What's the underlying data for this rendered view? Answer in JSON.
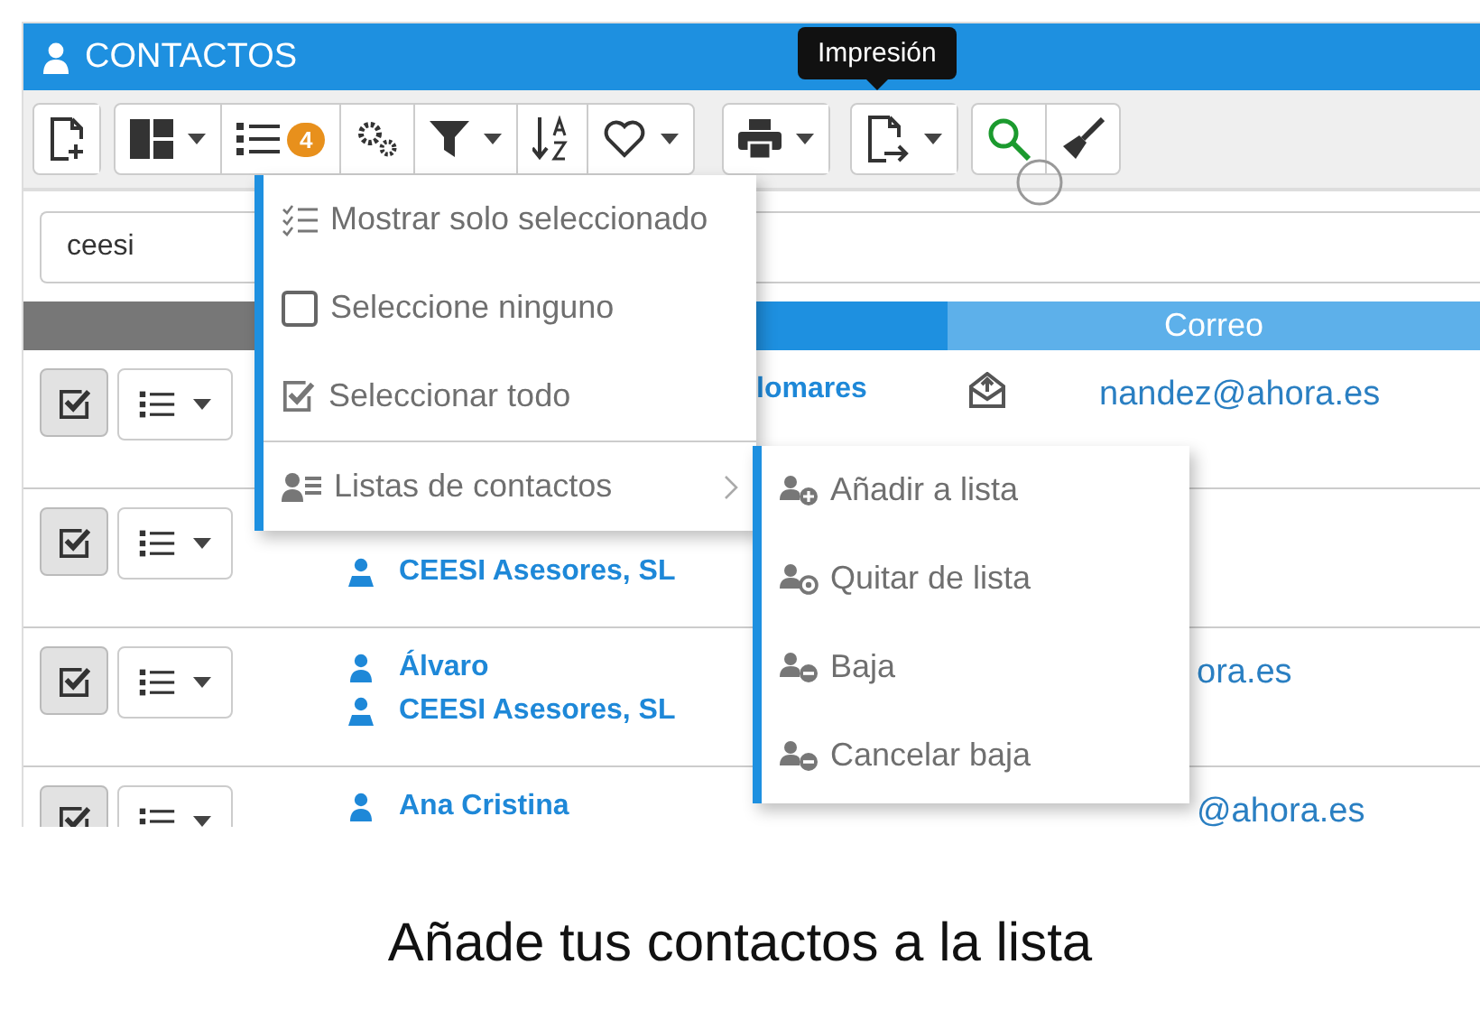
{
  "header": {
    "title": "CONTACTOS"
  },
  "toolbar": {
    "groups": [
      [
        {
          "kind": "new-doc",
          "dropdown": false
        }
      ],
      [
        {
          "kind": "layout",
          "dropdown": true
        },
        {
          "kind": "list",
          "dropdown": false,
          "badge": "4"
        },
        {
          "kind": "gears",
          "dropdown": false
        },
        {
          "kind": "filter",
          "dropdown": true
        },
        {
          "kind": "sort",
          "dropdown": false
        },
        {
          "kind": "heart",
          "dropdown": true
        }
      ],
      [
        {
          "kind": "printer",
          "dropdown": true
        }
      ],
      [
        {
          "kind": "export",
          "dropdown": true
        }
      ],
      [
        {
          "kind": "search",
          "dropdown": false
        },
        {
          "kind": "broom",
          "dropdown": false
        }
      ]
    ]
  },
  "tooltip": {
    "text": "Impresión"
  },
  "search": {
    "value": "ceesi"
  },
  "table": {
    "columns": [
      {
        "label": "Correo"
      }
    ],
    "rows": [
      {
        "checked": true,
        "name": "lomares",
        "company": "",
        "email": "nandez@ahora.es",
        "mail_icon": true
      },
      {
        "checked": true,
        "name": "",
        "company": "CEESI Asesores, SL",
        "email": "",
        "mail_icon": false
      },
      {
        "checked": true,
        "name": "Álvaro",
        "company": "CEESI Asesores, SL",
        "email": "ora.es",
        "mail_icon": false
      },
      {
        "checked": true,
        "name": "Ana Cristina",
        "company": "",
        "email": "@ahora.es",
        "mail_icon": false
      }
    ]
  },
  "menu": {
    "items": [
      {
        "kind": "check-list",
        "label": "Mostrar solo seleccionado",
        "submenu": false
      },
      {
        "kind": "box-empty",
        "label": "Seleccione ninguno",
        "submenu": false
      },
      {
        "kind": "box-checked",
        "label": "Seleccionar todo",
        "submenu": false
      },
      {
        "kind": "contacts",
        "label": "Listas de contactos",
        "submenu": true
      }
    ]
  },
  "submenu": {
    "items": [
      {
        "kind": "user-plus",
        "label": "Añadir a lista"
      },
      {
        "kind": "user-remove",
        "label": "Quitar de lista"
      },
      {
        "kind": "user-minus",
        "label": "Baja"
      },
      {
        "kind": "user-minus",
        "label": "Cancelar baja"
      }
    ]
  },
  "caption": "Añade tus contactos a la lista"
}
